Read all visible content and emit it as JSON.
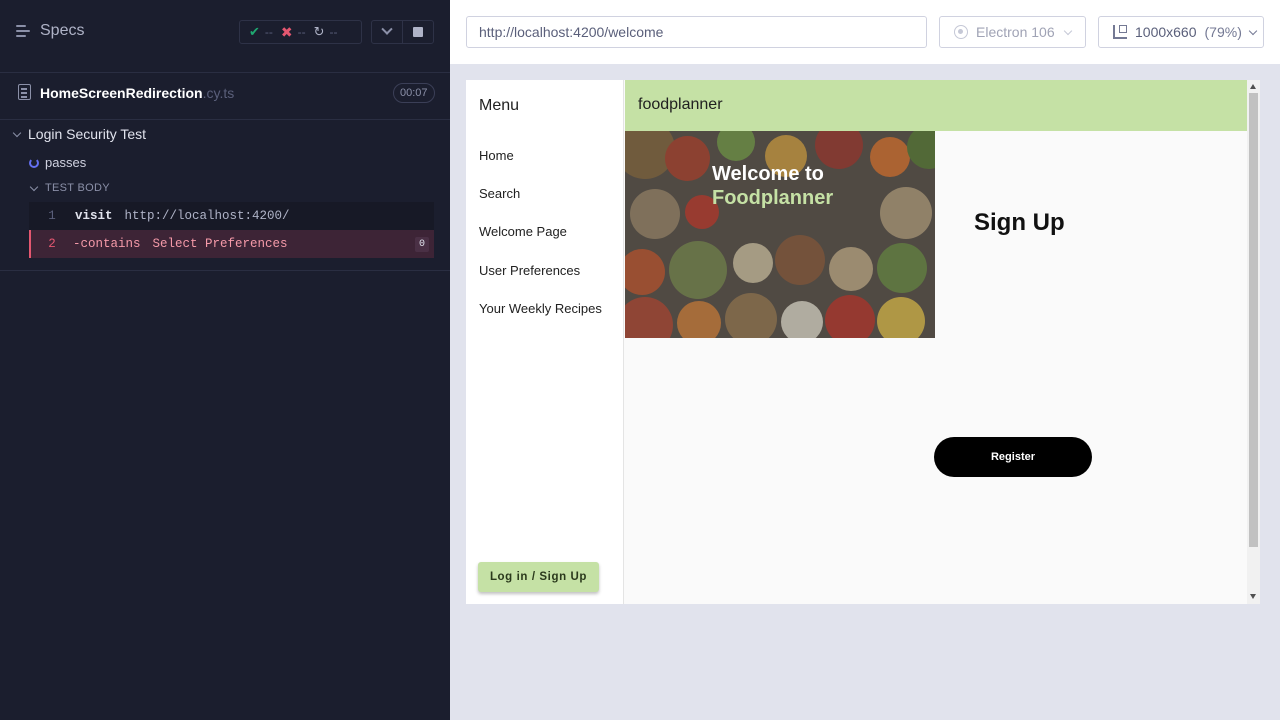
{
  "reporter": {
    "specs_label": "Specs",
    "stats": {
      "passed": "--",
      "failed": "--",
      "pending": "--"
    },
    "spec": {
      "name": "HomeScreenRedirection",
      "ext": ".cy.ts",
      "duration": "00:07"
    },
    "suite_title": "Login Security Test",
    "test_title": "passes",
    "body_label": "TEST BODY",
    "commands": [
      {
        "num": "1",
        "name": "visit",
        "arg": "http://localhost:4200/",
        "state": "passed"
      },
      {
        "num": "2",
        "name": "-contains",
        "arg": "Select Preferences",
        "state": "failed",
        "badge": "0"
      }
    ]
  },
  "aut": {
    "url": "http://localhost:4200/welcome",
    "browser": "Electron 106",
    "viewport": "1000x660",
    "zoom": "(79%)"
  },
  "app": {
    "menu_title": "Menu",
    "nav": [
      "Home",
      "Search",
      "Welcome Page",
      "User Preferences",
      "Your Weekly Recipes"
    ],
    "login_button": "Log in / Sign Up",
    "title": "foodplanner",
    "hero": {
      "line1": "Welcome to",
      "line2": "Foodplanner"
    },
    "signup_heading": "Sign Up",
    "register_button": "Register"
  },
  "colors": {
    "accent_green": "#c5e1a5",
    "fail_red": "#e45770",
    "pass_green": "#1fa971",
    "reporter_bg": "#1b1e2e"
  }
}
